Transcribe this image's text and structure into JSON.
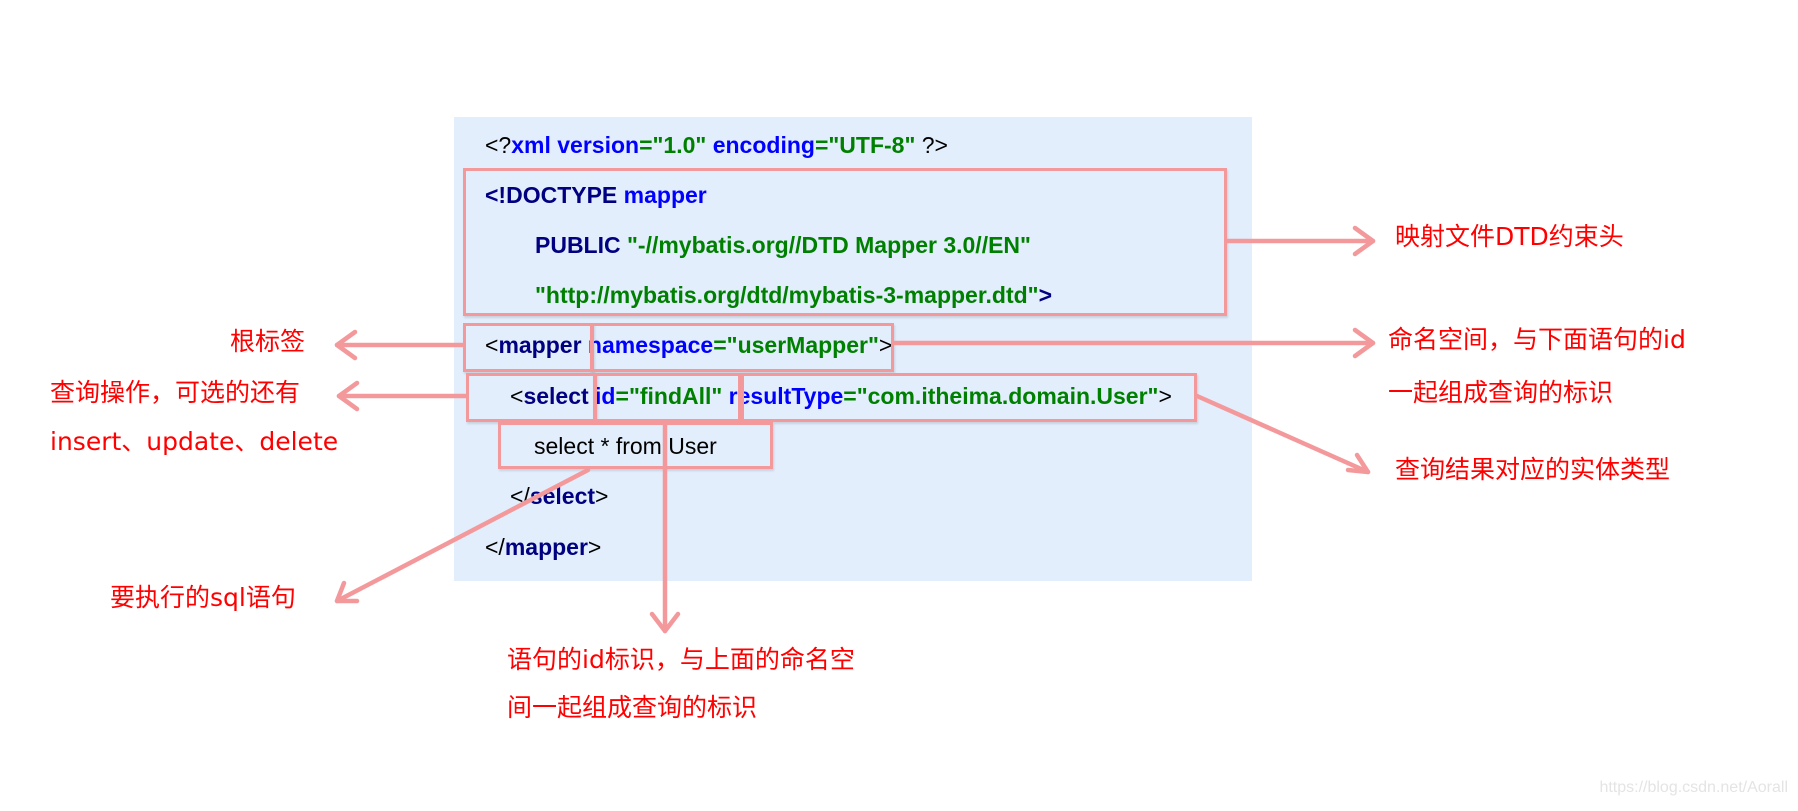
{
  "code_lines": {
    "xml_decl": {
      "open": "<?",
      "xml": "xml ",
      "version_attr": "version",
      "eq1": "=",
      "version_val": "\"1.0\"",
      "encoding_attr": " encoding",
      "eq2": "=",
      "encoding_val": "\"UTF-8\"",
      "close": " ?>"
    },
    "doctype": {
      "keyword": "<!DOCTYPE ",
      "name": "mapper"
    },
    "public": {
      "keyword": "PUBLIC ",
      "value": "\"-//mybatis.org//DTD Mapper 3.0//EN\""
    },
    "dtd_url": {
      "value": "\"http://mybatis.org/dtd/mybatis-3-mapper.dtd\"",
      "close": ">"
    },
    "mapper_open": {
      "lt": "<",
      "tag": "mapper",
      "attr": " namespace",
      "eq": "=",
      "value": "\"userMapper\"",
      "close": ">"
    },
    "select_open": {
      "lt": "<",
      "tag": "select",
      "id_attr": " id",
      "eq1": "=",
      "id_value": "\"findAll\"",
      "rt_attr": " resultType",
      "eq2": "=",
      "rt_value": "\"com.itheima.domain.User\"",
      "close": ">"
    },
    "sql": "select * from User",
    "select_close": {
      "lt": "</",
      "tag": "select",
      "close": ">"
    },
    "mapper_close": {
      "lt": "</",
      "tag": "mapper",
      "close": ">"
    }
  },
  "annotations": {
    "dtd_header": "映射文件DTD约束头",
    "namespace_line1": "命名空间，与下面语句的id",
    "namespace_line2": "一起组成查询的标识",
    "result_type": "查询结果对应的实体类型",
    "root_tag": "根标签",
    "select_op_line1": "查询操作，可选的还有",
    "select_op_line2": "insert、update、delete",
    "sql_statement": "要执行的sql语句",
    "statement_id_line1": "语句的id标识，与上面的命名空",
    "statement_id_line2": "间一起组成查询的标识"
  },
  "watermark": "https://blog.csdn.net/Aorall",
  "colors": {
    "panel": "#e3eefc",
    "highlight_box": "#f4999b",
    "annotation_text": "#ff0000",
    "tag_navy": "#000080",
    "attr_blue": "#0000ff",
    "value_green": "#008000"
  }
}
